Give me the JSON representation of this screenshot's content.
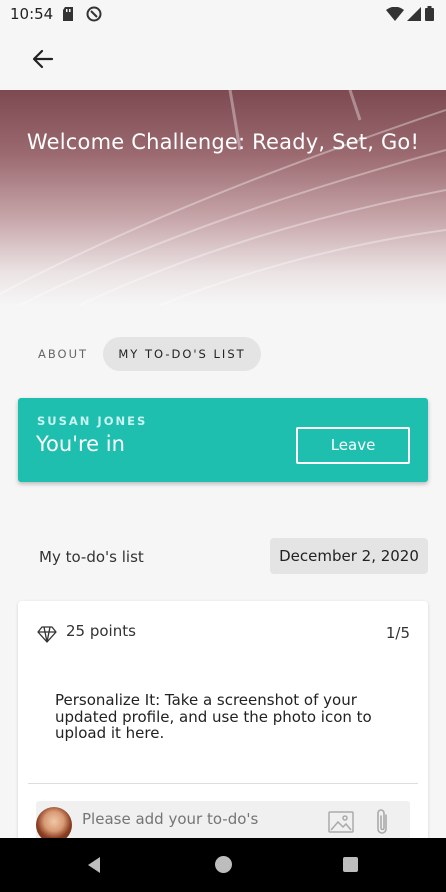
{
  "status_bar": {
    "time": "10:54"
  },
  "hero": {
    "title": "Welcome Challenge: Ready, Set, Go!"
  },
  "tabs": [
    {
      "label": "ABOUT",
      "active": false
    },
    {
      "label": "MY TO-DO'S LIST",
      "active": true
    }
  ],
  "join_card": {
    "user_name": "SUSAN JONES",
    "status": "You're in",
    "leave_label": "Leave",
    "color": "#1fbfb0"
  },
  "todo": {
    "header": "My to-do's list",
    "date": "December 2, 2020"
  },
  "task": {
    "points": "25 points",
    "progress": "1/5",
    "description": "Personalize It: Take a screenshot of your updated profile, and use the photo icon to upload it here.",
    "comment_placeholder": "Please add your to-do's"
  },
  "icons": [
    "back-arrow-icon",
    "diamond-icon",
    "photo-icon",
    "paperclip-icon"
  ]
}
